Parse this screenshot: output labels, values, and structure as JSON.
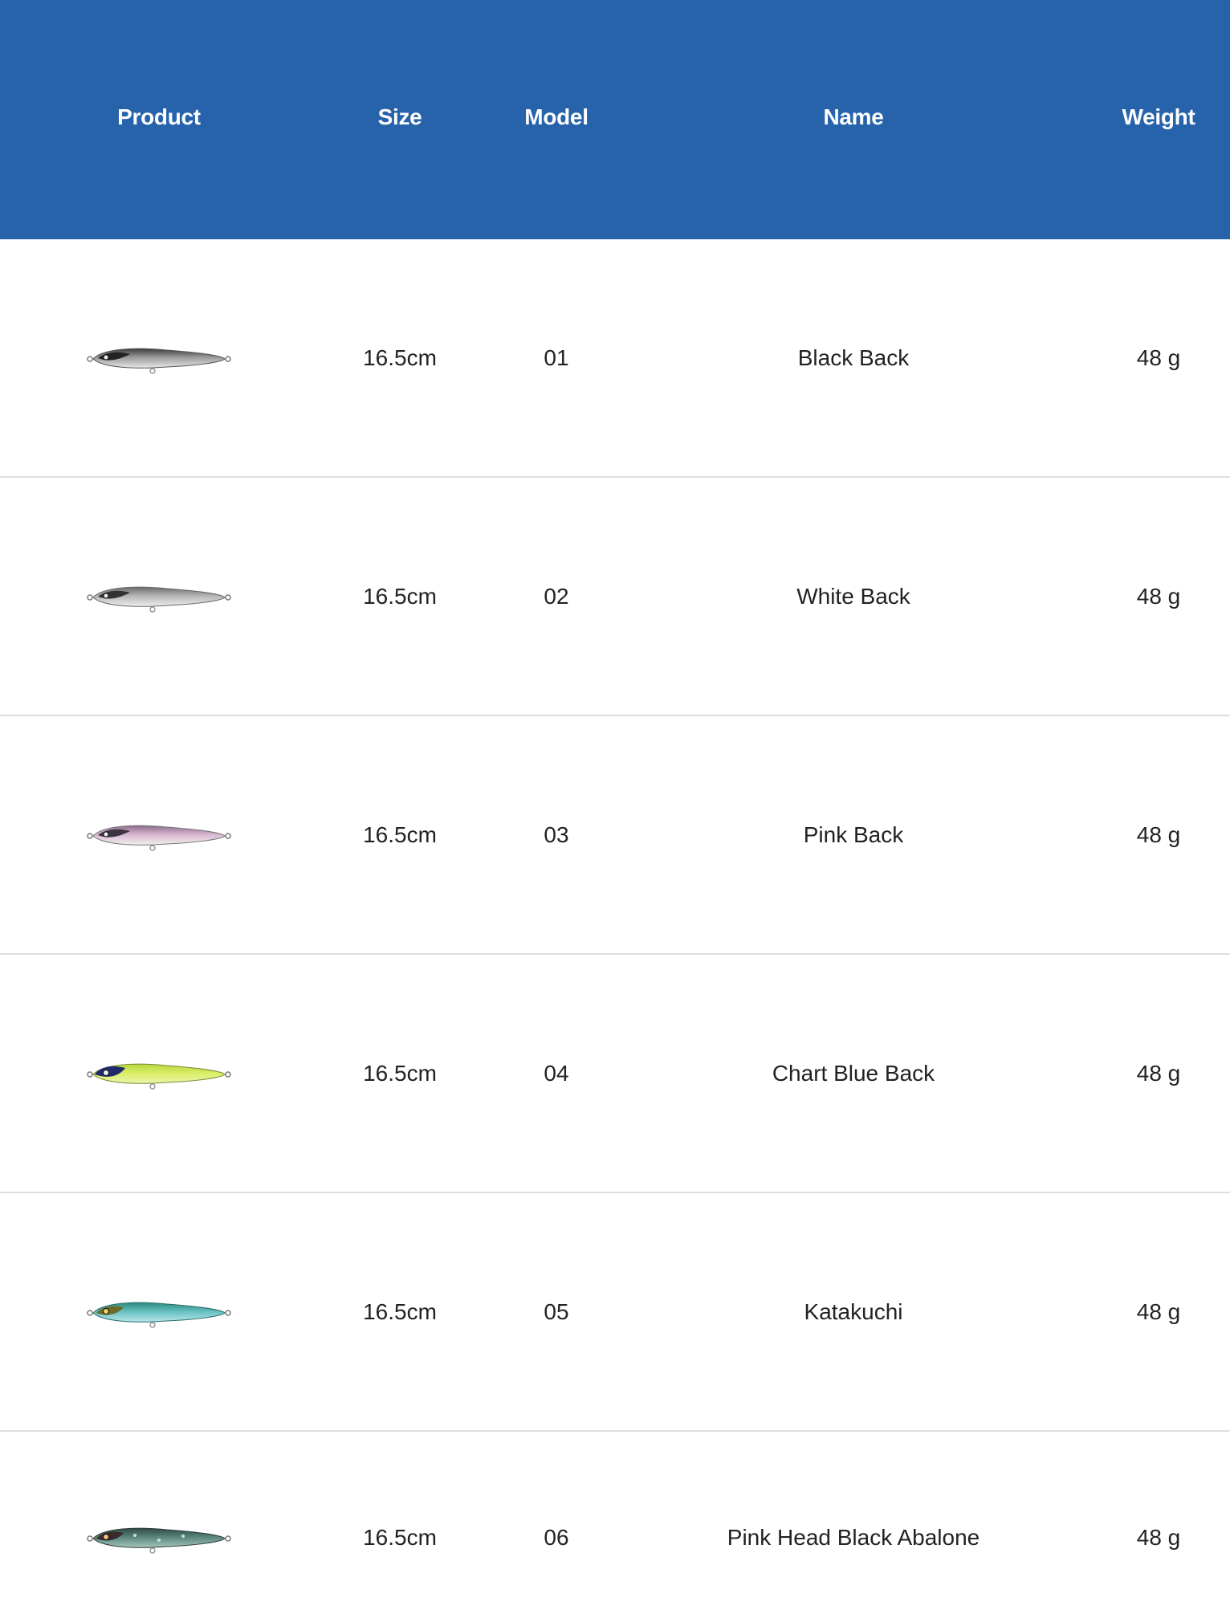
{
  "table": {
    "headers": {
      "product": "Product",
      "size": "Size",
      "model": "Model",
      "name": "Name",
      "weight": "Weight"
    },
    "header_color": "#2763ab",
    "rows": [
      {
        "size": "16.5cm",
        "model": "01",
        "name": "Black Back",
        "weight": "48 g",
        "image": "lure-black-back"
      },
      {
        "size": "16.5cm",
        "model": "02",
        "name": "White Back",
        "weight": "48 g",
        "image": "lure-white-back"
      },
      {
        "size": "16.5cm",
        "model": "03",
        "name": "Pink Back",
        "weight": "48 g",
        "image": "lure-pink-back"
      },
      {
        "size": "16.5cm",
        "model": "04",
        "name": "Chart Blue Back",
        "weight": "48 g",
        "image": "lure-chart-blue-back"
      },
      {
        "size": "16.5cm",
        "model": "05",
        "name": "Katakuchi",
        "weight": "48 g",
        "image": "lure-katakuchi"
      },
      {
        "size": "16.5cm",
        "model": "06",
        "name": "Pink Head Black Abalone",
        "weight": "48 g",
        "image": "lure-pink-head-black-abalone"
      }
    ]
  }
}
